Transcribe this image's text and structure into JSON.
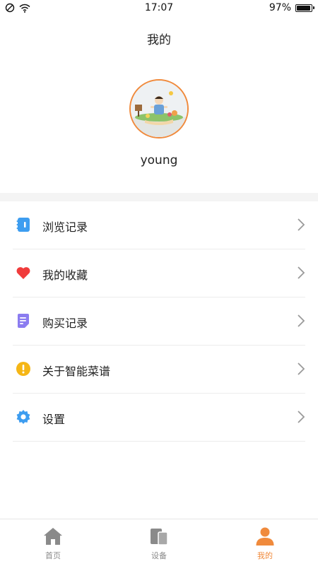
{
  "status_bar": {
    "time": "17:07",
    "battery": "97%",
    "battery_level": 0.97
  },
  "header": {
    "title": "我的"
  },
  "profile": {
    "username": "young"
  },
  "menu": {
    "items": [
      {
        "label": "浏览记录",
        "icon": "history-icon",
        "color": "#3d9df0"
      },
      {
        "label": "我的收藏",
        "icon": "heart-icon",
        "color": "#f03c3c"
      },
      {
        "label": "购买记录",
        "icon": "receipt-icon",
        "color": "#8b7cf0"
      },
      {
        "label": "关于智能菜谱",
        "icon": "info-icon",
        "color": "#f5b616"
      },
      {
        "label": "设置",
        "icon": "gear-icon",
        "color": "#3d9df0"
      }
    ]
  },
  "tab_bar": {
    "tabs": [
      {
        "label": "首页",
        "icon": "home-icon"
      },
      {
        "label": "设备",
        "icon": "devices-icon"
      },
      {
        "label": "我的",
        "icon": "person-icon",
        "active": true
      }
    ],
    "active_color": "#f08a3c",
    "inactive_color": "#8a8a8a"
  }
}
